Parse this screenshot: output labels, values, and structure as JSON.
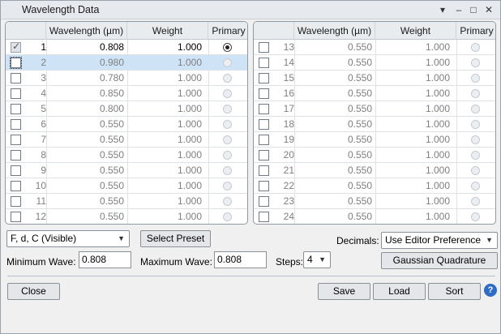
{
  "window": {
    "title": "Wavelength Data",
    "controls": {
      "menu": "▾",
      "minimize": "–",
      "maximize": "□",
      "close": "✕"
    }
  },
  "grid_headers": {
    "wavelength": "Wavelength (µm)",
    "weight": "Weight",
    "primary": "Primary"
  },
  "left_rows": [
    {
      "num": "1",
      "checked": true,
      "wavelength": "0.808",
      "weight": "1.000",
      "primary": true,
      "active": true,
      "selected": false
    },
    {
      "num": "2",
      "checked": false,
      "wavelength": "0.980",
      "weight": "1.000",
      "primary": false,
      "active": false,
      "selected": true
    },
    {
      "num": "3",
      "checked": false,
      "wavelength": "0.780",
      "weight": "1.000",
      "primary": false,
      "active": false,
      "selected": false
    },
    {
      "num": "4",
      "checked": false,
      "wavelength": "0.850",
      "weight": "1.000",
      "primary": false,
      "active": false,
      "selected": false
    },
    {
      "num": "5",
      "checked": false,
      "wavelength": "0.800",
      "weight": "1.000",
      "primary": false,
      "active": false,
      "selected": false
    },
    {
      "num": "6",
      "checked": false,
      "wavelength": "0.550",
      "weight": "1.000",
      "primary": false,
      "active": false,
      "selected": false
    },
    {
      "num": "7",
      "checked": false,
      "wavelength": "0.550",
      "weight": "1.000",
      "primary": false,
      "active": false,
      "selected": false
    },
    {
      "num": "8",
      "checked": false,
      "wavelength": "0.550",
      "weight": "1.000",
      "primary": false,
      "active": false,
      "selected": false
    },
    {
      "num": "9",
      "checked": false,
      "wavelength": "0.550",
      "weight": "1.000",
      "primary": false,
      "active": false,
      "selected": false
    },
    {
      "num": "10",
      "checked": false,
      "wavelength": "0.550",
      "weight": "1.000",
      "primary": false,
      "active": false,
      "selected": false
    },
    {
      "num": "11",
      "checked": false,
      "wavelength": "0.550",
      "weight": "1.000",
      "primary": false,
      "active": false,
      "selected": false
    },
    {
      "num": "12",
      "checked": false,
      "wavelength": "0.550",
      "weight": "1.000",
      "primary": false,
      "active": false,
      "selected": false
    }
  ],
  "right_rows": [
    {
      "num": "13",
      "checked": false,
      "wavelength": "0.550",
      "weight": "1.000",
      "primary": false,
      "active": false,
      "selected": false
    },
    {
      "num": "14",
      "checked": false,
      "wavelength": "0.550",
      "weight": "1.000",
      "primary": false,
      "active": false,
      "selected": false
    },
    {
      "num": "15",
      "checked": false,
      "wavelength": "0.550",
      "weight": "1.000",
      "primary": false,
      "active": false,
      "selected": false
    },
    {
      "num": "16",
      "checked": false,
      "wavelength": "0.550",
      "weight": "1.000",
      "primary": false,
      "active": false,
      "selected": false
    },
    {
      "num": "17",
      "checked": false,
      "wavelength": "0.550",
      "weight": "1.000",
      "primary": false,
      "active": false,
      "selected": false
    },
    {
      "num": "18",
      "checked": false,
      "wavelength": "0.550",
      "weight": "1.000",
      "primary": false,
      "active": false,
      "selected": false
    },
    {
      "num": "19",
      "checked": false,
      "wavelength": "0.550",
      "weight": "1.000",
      "primary": false,
      "active": false,
      "selected": false
    },
    {
      "num": "20",
      "checked": false,
      "wavelength": "0.550",
      "weight": "1.000",
      "primary": false,
      "active": false,
      "selected": false
    },
    {
      "num": "21",
      "checked": false,
      "wavelength": "0.550",
      "weight": "1.000",
      "primary": false,
      "active": false,
      "selected": false
    },
    {
      "num": "22",
      "checked": false,
      "wavelength": "0.550",
      "weight": "1.000",
      "primary": false,
      "active": false,
      "selected": false
    },
    {
      "num": "23",
      "checked": false,
      "wavelength": "0.550",
      "weight": "1.000",
      "primary": false,
      "active": false,
      "selected": false
    },
    {
      "num": "24",
      "checked": false,
      "wavelength": "0.550",
      "weight": "1.000",
      "primary": false,
      "active": false,
      "selected": false
    }
  ],
  "controls": {
    "preset_select": "F, d, C (Visible)",
    "select_preset_button": "Select Preset",
    "decimals_label": "Decimals:",
    "decimals_select": "Use Editor Preference",
    "min_wave_label": "Minimum Wave:",
    "min_wave_value": "0.808",
    "max_wave_label": "Maximum Wave:",
    "max_wave_value": "0.808",
    "steps_label": "Steps:",
    "steps_value": "4",
    "gaussian_button": "Gaussian Quadrature"
  },
  "footer": {
    "close": "Close",
    "save": "Save",
    "load": "Load",
    "sort": "Sort",
    "help": "?"
  }
}
